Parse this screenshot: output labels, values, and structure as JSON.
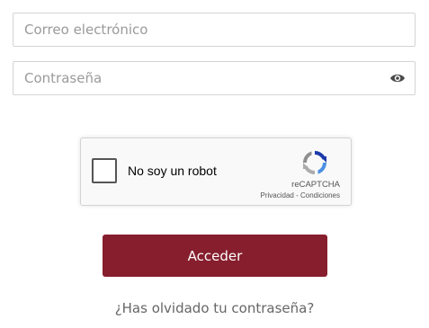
{
  "form": {
    "email": {
      "placeholder": "Correo electrónico",
      "value": ""
    },
    "password": {
      "placeholder": "Contraseña",
      "value": ""
    },
    "show_password_icon": "eye-icon",
    "submit_label": "Acceder",
    "forgot_password_link": "¿Has olvidado tu contraseña?"
  },
  "recaptcha": {
    "checkbox_label": "No soy un robot",
    "checked": false,
    "brand": "reCAPTCHA",
    "privacy_link": "Privacidad",
    "separator": " - ",
    "terms_link": "Condiciones",
    "logo_icon": "recaptcha-logo-icon"
  },
  "colors": {
    "accent": "#861e2d",
    "input_border": "#d4d4d4",
    "placeholder": "#9a9a9a",
    "link": "#666666"
  }
}
